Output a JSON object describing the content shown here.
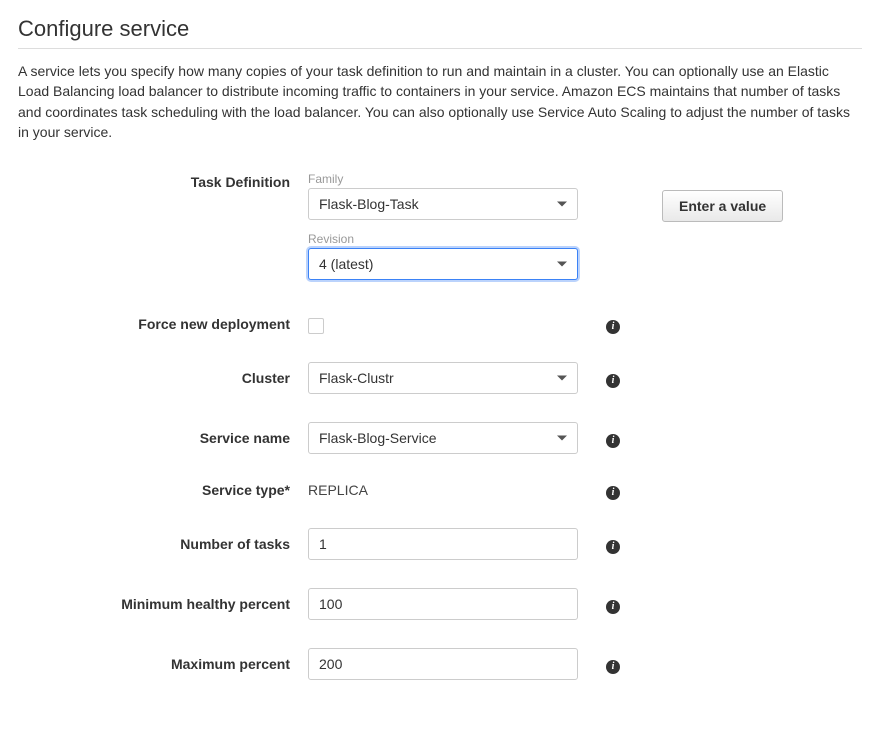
{
  "page": {
    "title": "Configure service",
    "description": "A service lets you specify how many copies of your task definition to run and maintain in a cluster. You can optionally use an Elastic Load Balancing load balancer to distribute incoming traffic to containers in your service. Amazon ECS maintains that number of tasks and coordinates task scheduling with the load balancer. You can also optionally use Service Auto Scaling to adjust the number of tasks in your service."
  },
  "form": {
    "task_definition": {
      "label": "Task Definition",
      "family_label": "Family",
      "family_value": "Flask-Blog-Task",
      "revision_label": "Revision",
      "revision_value": "4 (latest)",
      "enter_value_button": "Enter a value"
    },
    "force_new_deployment": {
      "label": "Force new deployment",
      "checked": false
    },
    "cluster": {
      "label": "Cluster",
      "value": "Flask-Clustr"
    },
    "service_name": {
      "label": "Service name",
      "value": "Flask-Blog-Service"
    },
    "service_type": {
      "label": "Service type*",
      "value": "REPLICA"
    },
    "number_of_tasks": {
      "label": "Number of tasks",
      "value": "1"
    },
    "minimum_healthy_percent": {
      "label": "Minimum healthy percent",
      "value": "100"
    },
    "maximum_percent": {
      "label": "Maximum percent",
      "value": "200"
    }
  }
}
